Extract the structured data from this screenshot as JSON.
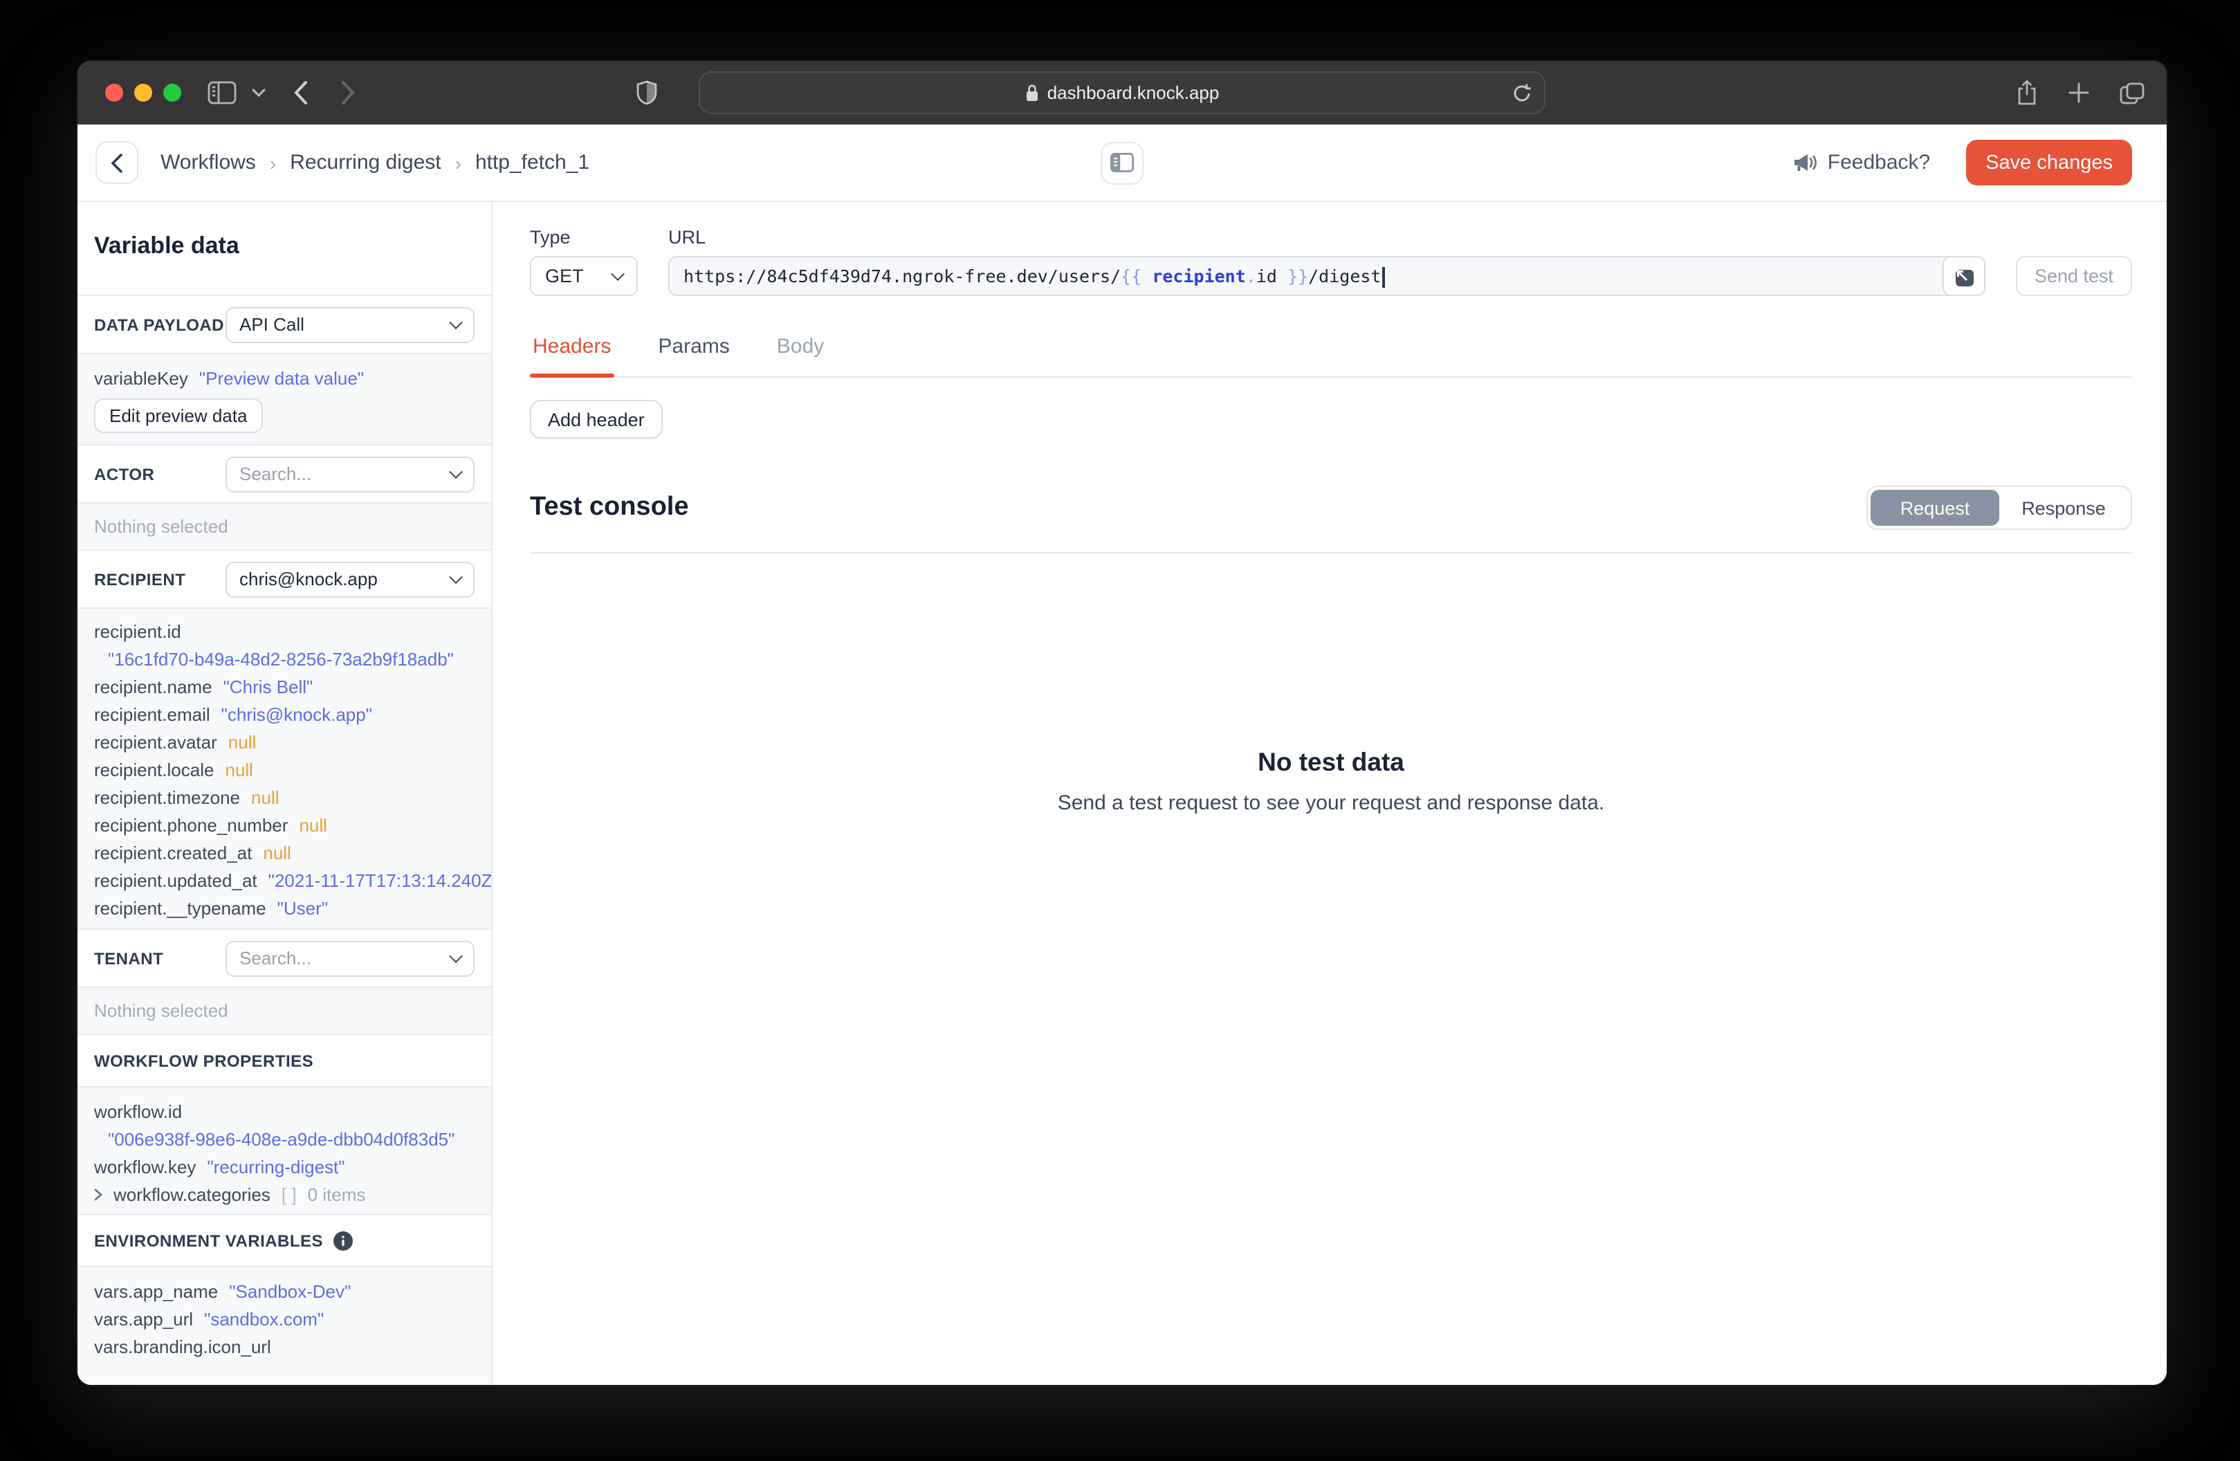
{
  "browser": {
    "address": "dashboard.knock.app"
  },
  "colors": {
    "accent_red": "#e4502e",
    "save_button_bg": "#e75339",
    "string_value": "#5d6ce5",
    "null_value": "#ec9f3a",
    "segment_active_bg": "#8a91a3",
    "titlebar_bg": "#373435"
  },
  "app_header": {
    "breadcrumb": {
      "items": [
        "Workflows",
        "Recurring digest",
        "http_fetch_1"
      ],
      "separator": "›"
    },
    "feedback_label": "Feedback?",
    "save_button": "Save changes"
  },
  "sidebar": {
    "title": "Variable data",
    "data_payload": {
      "label": "DATA PAYLOAD",
      "selected": "API Call"
    },
    "preview": {
      "key": "variableKey",
      "value": "\"Preview data value\"",
      "edit_button": "Edit preview data"
    },
    "actor": {
      "label": "ACTOR",
      "placeholder": "Search...",
      "empty": "Nothing selected"
    },
    "recipient": {
      "label": "RECIPIENT",
      "selected": "chris@knock.app",
      "rows": [
        {
          "key": "recipient.id"
        },
        {
          "value": "\"16c1fd70-b49a-48d2-8256-73a2b9f18adb\""
        },
        {
          "key": "recipient.name",
          "value": "\"Chris Bell\""
        },
        {
          "key": "recipient.email",
          "value": "\"chris@knock.app\""
        },
        {
          "key": "recipient.avatar",
          "value": "null"
        },
        {
          "key": "recipient.locale",
          "value": "null"
        },
        {
          "key": "recipient.timezone",
          "value": "null"
        },
        {
          "key": "recipient.phone_number",
          "value": "null"
        },
        {
          "key": "recipient.created_at",
          "value": "null"
        },
        {
          "key": "recipient.updated_at",
          "value": "\"2021-11-17T17:13:14.240Z\""
        },
        {
          "key": "recipient.__typename",
          "value": "\"User\""
        }
      ]
    },
    "tenant": {
      "label": "TENANT",
      "placeholder": "Search...",
      "empty": "Nothing selected"
    },
    "workflow": {
      "label": "WORKFLOW PROPERTIES",
      "rows": [
        {
          "key": "workflow.id"
        },
        {
          "value": "\"006e938f-98e6-408e-a9de-dbb04d0f83d5\""
        },
        {
          "key": "workflow.key",
          "value": "\"recurring-digest\""
        }
      ],
      "categories": {
        "key": "workflow.categories",
        "bracket": "[ ]",
        "count": "0 items"
      }
    },
    "env": {
      "label": "ENVIRONMENT VARIABLES",
      "rows": [
        {
          "key": "vars.app_name",
          "value": "\"Sandbox-Dev\""
        },
        {
          "key": "vars.app_url",
          "value": "\"sandbox.com\""
        },
        {
          "key": "vars.branding.icon_url"
        }
      ]
    }
  },
  "request": {
    "type_label": "Type",
    "type_value": "GET",
    "url_label": "URL",
    "url_segments": [
      {
        "t": "https://84c5df439d74.ngrok-free.dev/users/"
      },
      {
        "t": "{{ "
      },
      {
        "t": "recipient"
      },
      {
        "t": "."
      },
      {
        "t": "id"
      },
      {
        "t": " }}"
      },
      {
        "t": "/digest"
      }
    ],
    "send_test": "Send test",
    "tabs": [
      "Headers",
      "Params",
      "Body"
    ],
    "add_header": "Add header"
  },
  "console": {
    "title": "Test console",
    "toggle": [
      "Request",
      "Response"
    ],
    "empty_title": "No test data",
    "empty_subtitle": "Send a test request to see your request and response data."
  }
}
